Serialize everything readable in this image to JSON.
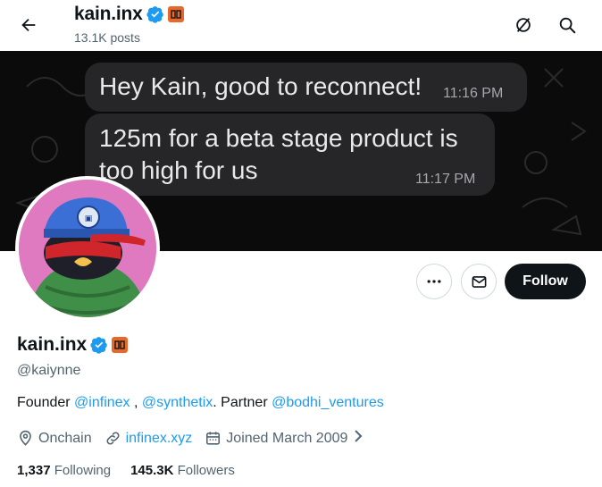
{
  "header": {
    "name": "kain.inx",
    "posts_count": "13.1K posts"
  },
  "banner": {
    "message1": "Hey Kain, good to reconnect!",
    "time1": "11:16 PM",
    "message2_line1": "125m for a beta stage product is",
    "message2_line2": "too high for us",
    "time2": "11:17 PM"
  },
  "actions": {
    "follow_label": "Follow"
  },
  "profile": {
    "name": "kain.inx",
    "handle": "@kaiynne",
    "bio_prefix": "Founder ",
    "bio_link1": "@infinex",
    "bio_sep": " , ",
    "bio_link2": "@synthetix",
    "bio_mid": ". Partner ",
    "bio_link3": "@bodhi_ventures",
    "location": "Onchain",
    "website": "infinex.xyz",
    "joined": "Joined March 2009"
  },
  "stats": {
    "following_count": "1,337",
    "following_label": "Following",
    "followers_count": "145.3K",
    "followers_label": "Followers"
  },
  "colors": {
    "accent": "#1d9bf0",
    "org_badge": "#e8682a",
    "avatar_bg": "#e07ac0"
  }
}
